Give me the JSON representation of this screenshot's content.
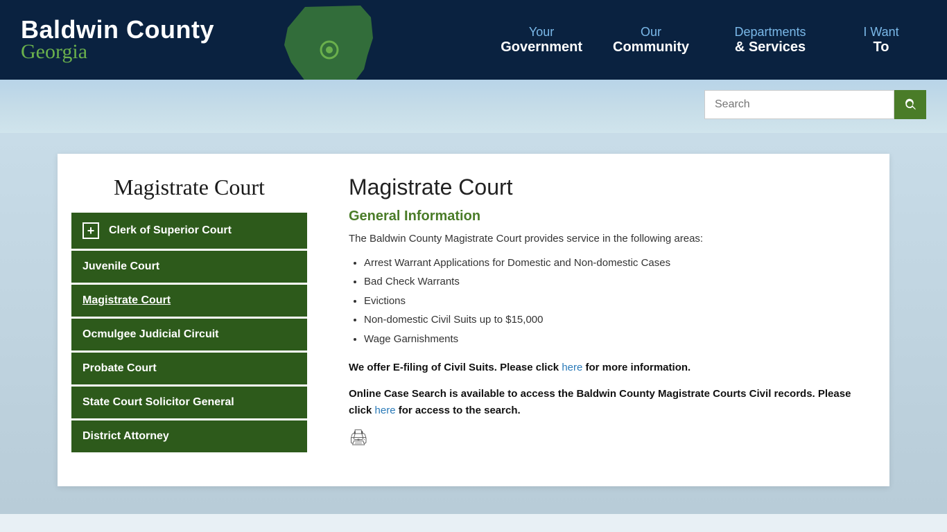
{
  "header": {
    "title_line1": "Baldwin County",
    "title_line2": "Georgia",
    "nav": [
      {
        "top": "Your",
        "bottom": "Government",
        "id": "your-government"
      },
      {
        "top": "Our",
        "bottom": "Community",
        "id": "our-community"
      },
      {
        "top": "Departments",
        "bottom": "& Services",
        "id": "departments-services"
      },
      {
        "top": "I Want",
        "bottom": "To",
        "id": "i-want-to"
      }
    ]
  },
  "search": {
    "placeholder": "Search",
    "button_label": "Search"
  },
  "sidebar": {
    "title": "Magistrate Court",
    "menu_items": [
      {
        "id": "clerk-superior-court",
        "label": "Clerk of Superior Court",
        "has_expand": true,
        "active": false
      },
      {
        "id": "juvenile-court",
        "label": "Juvenile Court",
        "has_expand": false,
        "active": false
      },
      {
        "id": "magistrate-court",
        "label": "Magistrate Court",
        "has_expand": false,
        "active": true
      },
      {
        "id": "ocmulgee-judicial-circuit",
        "label": "Ocmulgee Judicial Circuit",
        "has_expand": false,
        "active": false
      },
      {
        "id": "probate-court",
        "label": "Probate Court",
        "has_expand": false,
        "active": false
      },
      {
        "id": "state-court-solicitor-general",
        "label": "State Court Solicitor General",
        "has_expand": false,
        "active": false
      },
      {
        "id": "district-attorney",
        "label": "District Attorney",
        "has_expand": false,
        "active": false
      }
    ]
  },
  "main_content": {
    "page_title": "Magistrate Court",
    "section_heading": "General Information",
    "intro_text": "The Baldwin County Magistrate Court provides service in the following areas:",
    "services": [
      "Arrest Warrant Applications for Domestic and Non-domestic Cases",
      "Bad Check Warrants",
      "Evictions",
      "Non-domestic Civil Suits up to $15,000",
      "Wage Garnishments"
    ],
    "efiling_text_before": "We offer E-filing of Civil Suits. Please click ",
    "efiling_link": "here",
    "efiling_text_after": " for more information.",
    "online_case_text_before": "Online Case Search is available to access the Baldwin County Magistrate Courts Civil records. Please click ",
    "online_case_link": "here",
    "online_case_text_after": " for access to the search."
  },
  "colors": {
    "nav_bg": "#0a2240",
    "green_dark": "#2d5a1b",
    "green_accent": "#4a7c28",
    "link_color": "#2a7ab8",
    "logo_green": "#6ab04c"
  }
}
